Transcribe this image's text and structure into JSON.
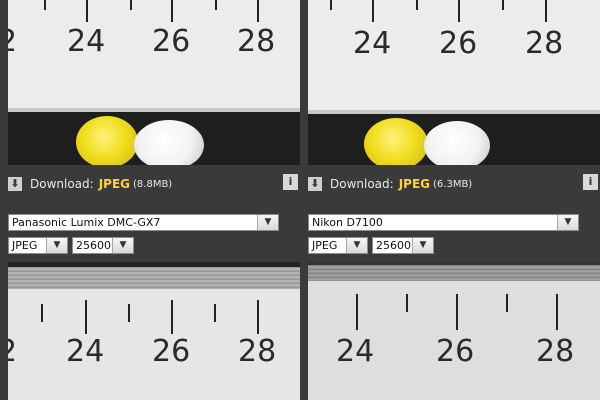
{
  "panels": [
    {
      "ruler_top": [
        "24",
        "26",
        "28"
      ],
      "partial_top": "2",
      "download": {
        "label": "Download:",
        "format": "JPEG",
        "size": "(8.8MB)"
      },
      "camera": "Panasonic Lumix DMC-GX7",
      "format": "JPEG",
      "iso": "25600",
      "ruler_bottom": [
        "24",
        "26",
        "28"
      ],
      "partial_bottom": "2"
    },
    {
      "ruler_top": [
        "24",
        "26",
        "28"
      ],
      "download": {
        "label": "Download:",
        "format": "JPEG",
        "size": "(6.3MB)"
      },
      "camera": "Nikon D7100",
      "format": "JPEG",
      "iso": "25600",
      "ruler_bottom": [
        "24",
        "26",
        "28"
      ]
    }
  ],
  "icons": {
    "download": "download-icon",
    "info": "info-icon",
    "dropdown": "chevron-down-icon"
  },
  "info_label": "i",
  "colors": {
    "background": "#3a3a3a",
    "format_highlight": "#ffd33a",
    "label": "#e9e9e9"
  }
}
